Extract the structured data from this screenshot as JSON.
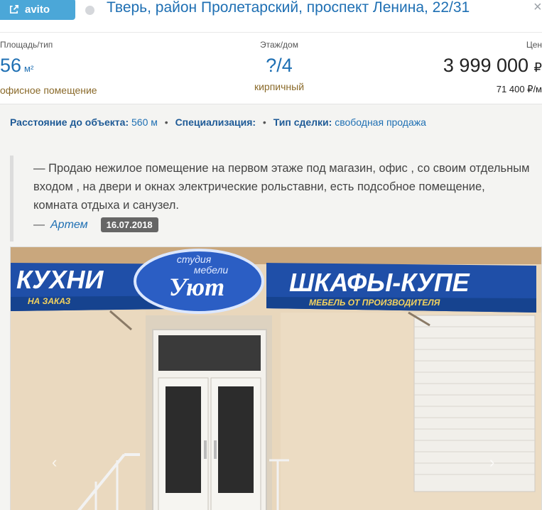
{
  "header": {
    "badge_label": "avito",
    "address": "Тверь, район Пролетарский, проспект Ленина, 22/31",
    "close_glyph": "×"
  },
  "stats": {
    "area": {
      "label": "Площадь/тип",
      "value": "56",
      "unit": "м²",
      "sub": "офисное помещение"
    },
    "floor": {
      "label": "Этаж/дом",
      "value": "?/4",
      "sub": "кирпичный"
    },
    "price": {
      "label": "Цен",
      "value": "3 999 000",
      "sub": "71 400 ₽/м"
    }
  },
  "details": {
    "distance_label": "Расстояние до объекта:",
    "distance_value": "560 м",
    "bullet": "•",
    "spec_label": "Специализация:",
    "deal_label": "Тип сделки:",
    "deal_value": "свободная продажа"
  },
  "quote": {
    "text": "— Продаю нежилое помещение на первом этаже под магазин, офис , со своим отдельным входом , на двери и окнах электрические рольставни, есть подсобное помещение, комната отдыха и санузел.",
    "dash": "—",
    "author": "Артем",
    "date": "16.07.2018"
  },
  "photo": {
    "sign_left": "КУХНИ",
    "sign_left_sub": "НА ЗАКАЗ",
    "sign_center_top": "студия",
    "sign_center_mid": "мебели",
    "sign_center_brand": "Уют",
    "sign_right": "ШКАФЫ-КУПЕ",
    "sign_right_sub": "МЕБЕЛЬ ОТ ПРОИЗВОДИТЕЛЯ",
    "prev_arrow": "‹",
    "next_arrow": "›"
  },
  "colors": {
    "accent": "#1e6fb3",
    "badge": "#4ba7d8",
    "sign_blue": "#1f4fa8"
  }
}
